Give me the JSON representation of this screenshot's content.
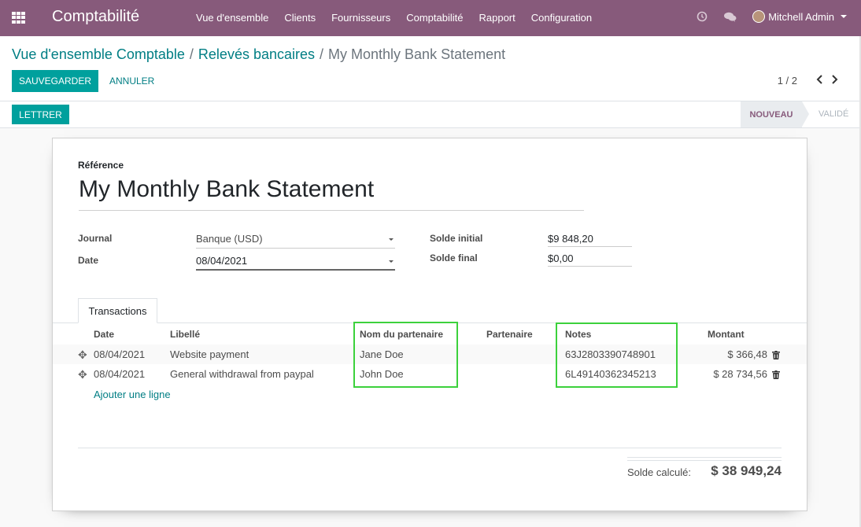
{
  "navbar": {
    "brand": "Comptabilité",
    "menu": [
      "Vue d'ensemble",
      "Clients",
      "Fournisseurs",
      "Comptabilité",
      "Rapport",
      "Configuration"
    ],
    "user": "Mitchell Admin"
  },
  "breadcrumb": {
    "items": [
      "Vue d'ensemble Comptable",
      "Relevés bancaires"
    ],
    "current": "My Monthly Bank Statement"
  },
  "actions": {
    "save": "SAUVEGARDER",
    "discard": "ANNULER",
    "reconcile": "LETTRER"
  },
  "pager": {
    "value": "1 / 2"
  },
  "status": {
    "current": "NOUVEAU",
    "next": "VALIDÉ"
  },
  "form": {
    "reference_label": "Référence",
    "reference": "My Monthly Bank Statement",
    "journal_label": "Journal",
    "journal": "Banque (USD)",
    "date_label": "Date",
    "date": "08/04/2021",
    "balance_start_label": "Solde initial",
    "balance_start": "9 848,20",
    "balance_end_label": "Solde final",
    "balance_end": "0,00",
    "currency": "$"
  },
  "tabs": [
    "Transactions"
  ],
  "table": {
    "headers": [
      "Date",
      "Libellé",
      "Nom du partenaire",
      "Partenaire",
      "Notes",
      "Montant"
    ],
    "rows": [
      {
        "date": "08/04/2021",
        "label": "Website payment",
        "partner_name": "Jane Doe",
        "partner": "",
        "notes": "63J2803390748901",
        "amount": "$ 366,48"
      },
      {
        "date": "08/04/2021",
        "label": "General withdrawal from paypal",
        "partner_name": "John Doe",
        "partner": "",
        "notes": "6L49140362345213",
        "amount": "$ 28 734,56"
      }
    ],
    "add_line": "Ajouter une ligne"
  },
  "totals": {
    "label": "Solde calculé:",
    "value": "$ 38 949,24"
  },
  "colors": {
    "navbar": "#875a7b",
    "primary": "#00a09d",
    "link": "#017e84",
    "highlight": "#3cd13c"
  }
}
